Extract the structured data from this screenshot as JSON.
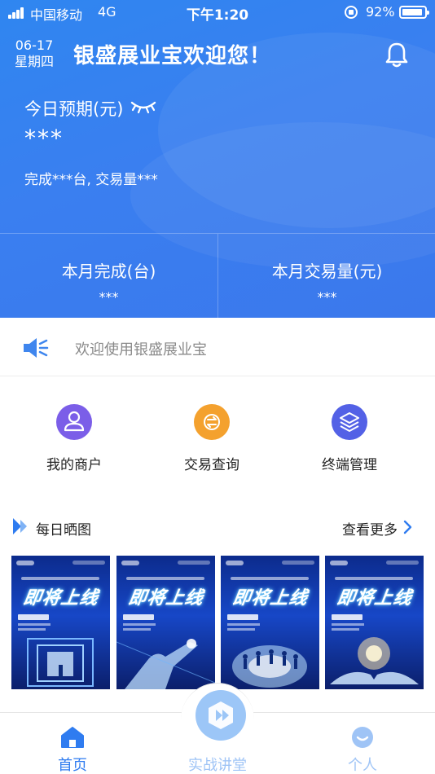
{
  "status_bar": {
    "carrier": "中国移动",
    "network": "4G",
    "time": "下午1:20",
    "battery": "92%"
  },
  "header": {
    "date": "06-17",
    "weekday": "星期四",
    "welcome": "银盛展业宝欢迎您！",
    "today_label": "今日预期(元)",
    "today_value": "***",
    "today_sub": "完成***台, 交易量***"
  },
  "stats": [
    {
      "label": "本月完成(台)",
      "value": "***"
    },
    {
      "label": "本月交易量(元)",
      "value": "***"
    }
  ],
  "notice": {
    "text": "欢迎使用银盛展业宝"
  },
  "quick_menu": [
    {
      "label": "我的商户",
      "icon": "person-icon",
      "color": "#7b5ee8"
    },
    {
      "label": "交易查询",
      "icon": "exchange-icon",
      "color": "#f4a12e"
    },
    {
      "label": "终端管理",
      "icon": "layers-icon",
      "color": "#5361e6"
    }
  ],
  "daily": {
    "title": "每日晒图",
    "more": "查看更多",
    "posters": [
      {
        "title": "即将上线"
      },
      {
        "title": "即将上线"
      },
      {
        "title": "即将上线"
      },
      {
        "title": "即将上线"
      }
    ]
  },
  "tabs": [
    {
      "label": "首页",
      "icon": "home-icon"
    },
    {
      "label": "实战讲堂",
      "icon": "play-icon"
    },
    {
      "label": "个人",
      "icon": "profile-icon"
    }
  ],
  "colors": {
    "primary": "#2f7cf0",
    "header_bg": "#3a7ff0"
  }
}
